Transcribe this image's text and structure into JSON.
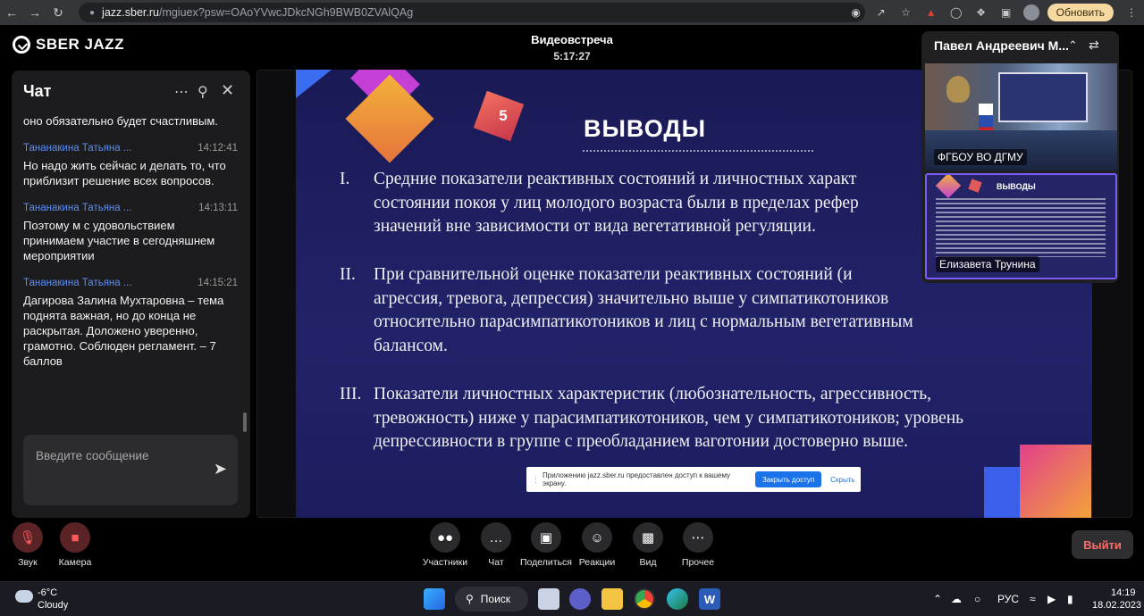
{
  "browser": {
    "url_host": "jazz.sber.ru",
    "url_path": "/mgiuex?psw=OAoYVwcJDkcNGh9BWB0ZVAlQAg",
    "update_label": "Обновить"
  },
  "app": {
    "logo_text": "SBER JAZZ",
    "meeting_title": "Видеовстреча",
    "meeting_time": "5:17:27"
  },
  "chat": {
    "title": "Чат",
    "messages": [
      {
        "author": "",
        "time": "",
        "text": "оно обязательно будет счастливым."
      },
      {
        "author": "Тананакина Татьяна ...",
        "time": "14:12:41",
        "text": "Но надо жить сейчас и делать то, что приблизит решение всех вопросов."
      },
      {
        "author": "Тананакина Татьяна ...",
        "time": "14:13:11",
        "text": "Поэтому м с удовольствием принимаем участие в сегодняшнем мероприятии"
      },
      {
        "author": "Тананакина Татьяна ...",
        "time": "14:15:21",
        "text": "Дагирова Залина Мухтаровна – тема поднята важная, но до конца не раскрытая. Доложено уверенно, грамотно. Соблюден регламент. – 7 баллов"
      }
    ],
    "input_placeholder": "Введите сообщение"
  },
  "slide": {
    "number": "5",
    "heading": "ВЫВОДЫ",
    "items": [
      {
        "num": "I.",
        "text": "Средние показатели реактивных состояний и личностных характ\nсостоянии покоя у лиц молодого возраста были в пределах рефер\nзначений вне зависимости от вида вегетативной регуляции."
      },
      {
        "num": "II.",
        "text": "При сравнительной оценке показатели реактивных состояний (и\nагрессия, тревога, депрессия) значительно выше у симпатикотоников\nотносительно парасимпатикотоников и лиц с нормальным вегетативным\nбалансом."
      },
      {
        "num": "III.",
        "text": "Показатели личностных характеристик (любознательность, агрессивность,\nтревожность) ниже у парасимпатикотоников, чем у симпатикотоников; уровень\nдепрессивности в группе с преобладанием ваготонии достоверно выше."
      }
    ]
  },
  "share_banner": {
    "text": "Приложению jazz.sber.ru предоставлен доступ к вашему экрану.",
    "stop_label": "Закрыть доступ",
    "hide_label": "Скрыть"
  },
  "participants": {
    "header": "Павел Андреевич М...",
    "tiles": [
      {
        "label": "ФГБОУ ВО ДГМУ"
      },
      {
        "label": "Елизавета Трунина"
      }
    ]
  },
  "controls": {
    "sound": "Звук",
    "camera": "Камера",
    "participants": "Участники",
    "chat": "Чат",
    "share": "Поделиться",
    "reactions": "Реакции",
    "view": "Вид",
    "more": "Прочее",
    "leave": "Выйти"
  },
  "taskbar": {
    "temp": "-6°C",
    "weather": "Cloudy",
    "search": "Поиск",
    "lang": "РУС",
    "time": "14:19",
    "date": "18.02.2023"
  }
}
